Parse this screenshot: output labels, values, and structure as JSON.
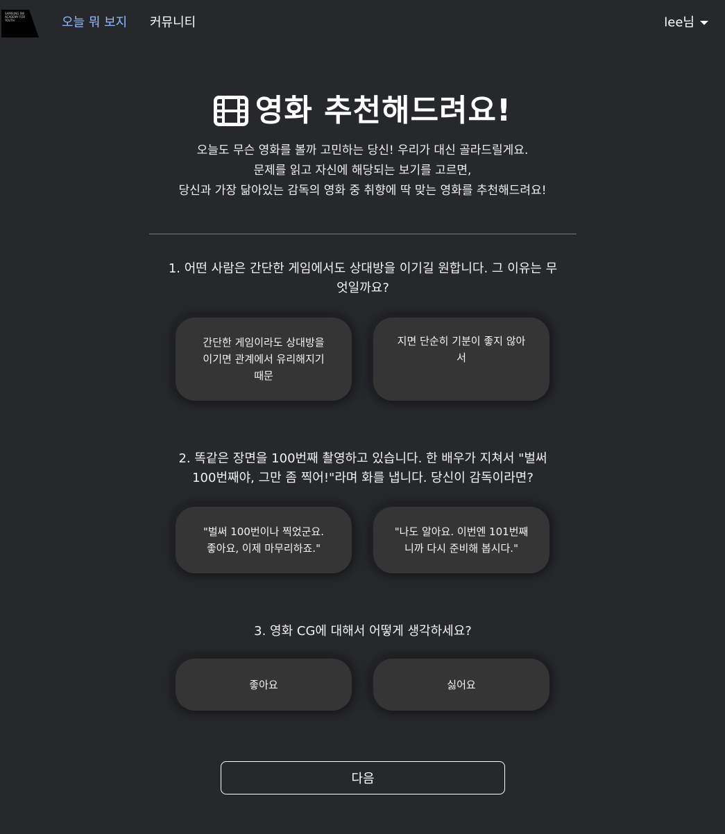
{
  "nav": {
    "logo_text": "SAMSUNG SW ACADEMY FOR YOUTH",
    "links": [
      "오늘 뭐 보지",
      "커뮤니티"
    ],
    "user": "lee님"
  },
  "hero": {
    "icon": "film-icon",
    "title": "영화 추천해드려요!",
    "intro": [
      "오늘도 무슨 영화를 볼까 고민하는 당신! 우리가 대신 골라드릴게요.",
      "문제를 읽고 자신에 해당되는 보기를 고르면,",
      "당신과 가장 닮아있는 감독의 영화 중 취향에 딱 맞는 영화를 추천해드려요!"
    ]
  },
  "questions": [
    {
      "lines": [
        "1. 어떤 사람은 간단한 게임에서도 상대방을 이기길 원합니다. 그 이유는 무",
        "엇일까요?"
      ],
      "options": [
        [
          "간단한 게임이라도 상대방을",
          "이기면 관계에서 유리해지기",
          "때문"
        ],
        [
          "지면 단순히 기분이 좋지 않아",
          "서"
        ]
      ]
    },
    {
      "lines": [
        "2. 똑같은 장면을 100번째 촬영하고 있습니다. 한 배우가 지쳐서 \"벌써",
        "100번째야, 그만 좀 찍어!\"라며 화를 냅니다. 당신이 감독이라면?"
      ],
      "options": [
        [
          "\"벌써 100번이나 찍었군요.",
          "좋아요, 이제 마무리하죠.\""
        ],
        [
          "\"나도 알아요. 이번엔 101번째",
          "니까 다시 준비해 봅시다.\""
        ]
      ]
    },
    {
      "lines": [
        "3. 영화 CG에 대해서 어떻게 생각하세요?"
      ],
      "options": [
        [
          "좋아요"
        ],
        [
          "싫어요"
        ]
      ]
    }
  ],
  "next_label": "다음"
}
